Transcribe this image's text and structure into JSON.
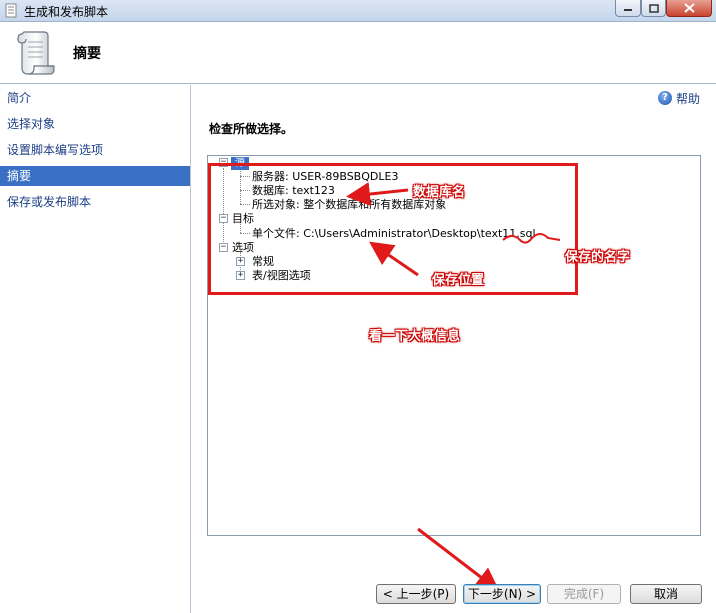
{
  "window": {
    "title": "生成和发布脚本",
    "controls": [
      "minimize",
      "maximize",
      "close"
    ]
  },
  "header": {
    "title": "摘要",
    "icon": "scroll-icon"
  },
  "sidebar": {
    "items": [
      {
        "label": "简介",
        "active": false
      },
      {
        "label": "选择对象",
        "active": false
      },
      {
        "label": "设置脚本编写选项",
        "active": false
      },
      {
        "label": "摘要",
        "active": true
      },
      {
        "label": "保存或发布脚本",
        "active": false
      }
    ]
  },
  "main": {
    "help_label": "帮助",
    "heading": "检查所做选择。",
    "tree": {
      "source_label": "源",
      "server": "服务器: USER-89BSBQDLE3",
      "database": "数据库: text123",
      "objects": "所选对象: 整个数据库和所有数据库对象",
      "target_label": "目标",
      "file": "单个文件: C:\\Users\\Administrator\\Desktop\\text11.sql",
      "options_label": "选项",
      "general": "常规",
      "table_view": "表/视图选项"
    }
  },
  "annotations": {
    "db_name": "数据库名",
    "save_name": "保存的名字",
    "save_location": "保存位置",
    "overview": "看一下大概信息",
    "color": "#e01a1a"
  },
  "buttons": {
    "back": "< 上一步(P)",
    "next": "下一步(N) >",
    "finish": "完成(F)",
    "cancel": "取消"
  }
}
